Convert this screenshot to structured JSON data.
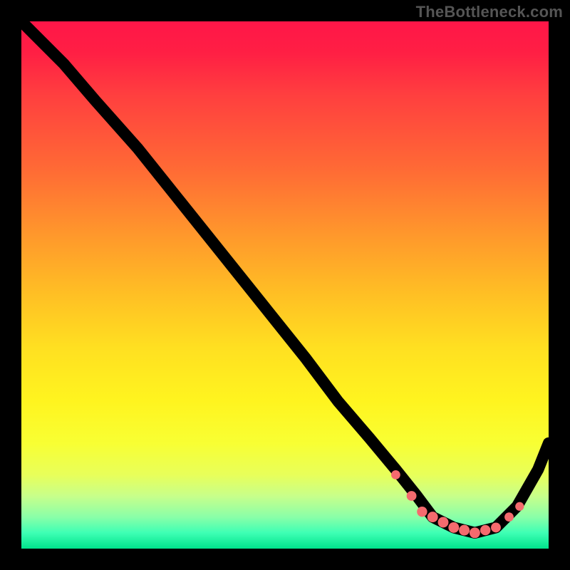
{
  "watermark": "TheBottleneck.com",
  "colors": {
    "frame_bg": "#000000",
    "curve": "#000000",
    "marker": "#f46a6e",
    "gradient_stops": [
      "#ff1648",
      "#ff1f44",
      "#ff3f3f",
      "#ff6a35",
      "#ff962c",
      "#ffc024",
      "#ffe021",
      "#fff41f",
      "#f8ff33",
      "#e8ff5a",
      "#c8ff8a",
      "#8affa8",
      "#3effb4",
      "#00e38c"
    ]
  },
  "chart_data": {
    "type": "line",
    "title": "",
    "xlabel": "",
    "ylabel": "",
    "xlim": [
      0,
      100
    ],
    "ylim": [
      0,
      100
    ],
    "note": "Axes hidden; values normalized 0–100 in plot coordinates (y=0 at bottom). Curve descends from top-left, flattens near bottom around x≈78–90, then rises toward the right edge.",
    "series": [
      {
        "name": "curve",
        "x": [
          0,
          4,
          8,
          14,
          22,
          30,
          38,
          46,
          54,
          60,
          66,
          71,
          75,
          78,
          82,
          86,
          90,
          94,
          98,
          100
        ],
        "y": [
          100,
          96,
          92,
          85,
          76,
          66,
          56,
          46,
          36,
          28,
          21,
          15,
          10,
          6,
          4,
          3,
          4,
          8,
          15,
          20
        ]
      }
    ],
    "markers": {
      "name": "highlight-points",
      "x": [
        71,
        74,
        76,
        78,
        80,
        82,
        84,
        86,
        88,
        90,
        92.5,
        94.5
      ],
      "y": [
        14,
        10,
        7,
        6,
        5,
        4,
        3.5,
        3,
        3.5,
        4,
        6,
        8
      ],
      "r": [
        4.8,
        5.2,
        5.4,
        5.6,
        5.6,
        5.6,
        5.6,
        5.6,
        5.4,
        5.2,
        4.8,
        4.6
      ]
    }
  }
}
